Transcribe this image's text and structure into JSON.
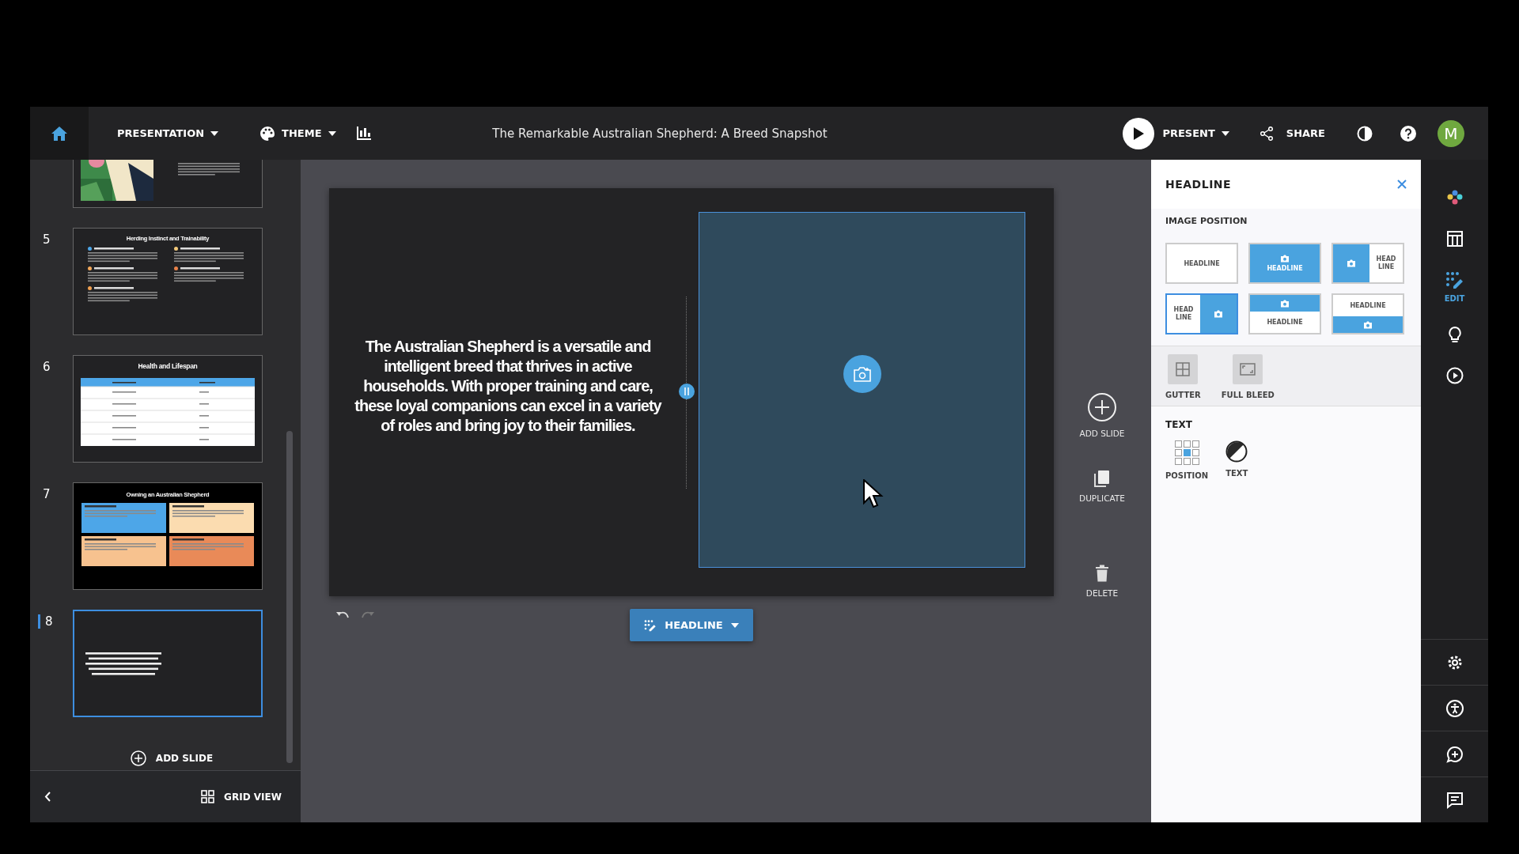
{
  "topbar": {
    "menus": [
      {
        "kind": "presentation",
        "label": "PRESENTATION"
      },
      {
        "kind": "theme",
        "label": "THEME"
      }
    ],
    "title": "The Remarkable Australian Shepherd: A Breed Snapshot",
    "present": "PRESENT",
    "share": "SHARE",
    "avatar": "M"
  },
  "slides": [
    {
      "kind": "photo-text",
      "selected": false
    },
    {
      "kind": "bullets",
      "number": "5",
      "title": "Herding Instinct and Trainability",
      "selected": false,
      "bullets": [
        {
          "color": "#4da6e8"
        },
        {
          "color": "#f3c97a"
        },
        {
          "color": "#f3a85a"
        },
        {
          "color": "#e9824a"
        },
        {
          "color": "#f0a050"
        }
      ]
    },
    {
      "kind": "table",
      "number": "6",
      "title": "Health and Lifespan",
      "selected": false
    },
    {
      "kind": "cards",
      "number": "7",
      "title": "Owning an Australian Shepherd",
      "selected": false,
      "cards": [
        {
          "color": "#4da6e8"
        },
        {
          "color": "#fbdcb0"
        },
        {
          "color": "#f7c28f"
        },
        {
          "color": "#e98a58"
        }
      ]
    },
    {
      "kind": "text",
      "number": "8",
      "selected": true
    }
  ],
  "add_slide": "ADD SLIDE",
  "grid_view": "GRID VIEW",
  "slide": {
    "text": "The Australian Shepherd is a versatile and intelligent breed that thrives in active households. With proper training and care, these loyal companions can excel in a variety of roles and bring joy to their families."
  },
  "layout_button": "HEADLINE",
  "actions": [
    {
      "kind": "add",
      "label": "ADD SLIDE"
    },
    {
      "kind": "duplicate",
      "label": "DUPLICATE"
    },
    {
      "kind": "delete",
      "label": "DELETE"
    }
  ],
  "panel": {
    "title": "HEADLINE",
    "image_position_label": "IMAGE POSITION",
    "layouts": [
      {
        "kind": "text-only",
        "label": "HEADLINE",
        "selected": false
      },
      {
        "kind": "image-behind",
        "label": "HEADLINE",
        "selected": false
      },
      {
        "kind": "image-left",
        "label": "HEAD LINE",
        "selected": false
      },
      {
        "kind": "image-right",
        "label": "HEAD LINE",
        "selected": true
      },
      {
        "kind": "image-top",
        "label": "HEADLINE",
        "selected": false
      },
      {
        "kind": "image-bottom",
        "label": "HEADLINE",
        "selected": false
      }
    ],
    "image_options": [
      {
        "kind": "gutter",
        "label": "GUTTER"
      },
      {
        "kind": "full-bleed",
        "label": "FULL BLEED"
      }
    ],
    "text_label": "TEXT",
    "text_options": [
      {
        "kind": "position",
        "label": "POSITION"
      },
      {
        "kind": "color",
        "label": "TEXT"
      }
    ],
    "position_grid": [
      {
        "selected": false
      },
      {
        "selected": false
      },
      {
        "selected": false
      },
      {
        "selected": false
      },
      {
        "selected": true
      },
      {
        "selected": false
      },
      {
        "selected": false
      },
      {
        "selected": false
      },
      {
        "selected": false
      }
    ]
  },
  "rail": [
    {
      "kind": "colors",
      "selected": false
    },
    {
      "kind": "layout",
      "selected": false
    },
    {
      "kind": "edit",
      "label": "EDIT",
      "selected": true
    },
    {
      "kind": "ideas",
      "selected": false
    },
    {
      "kind": "play",
      "selected": false
    },
    {
      "kind": "settings",
      "selected": false
    },
    {
      "kind": "accessibility",
      "selected": false
    },
    {
      "kind": "comment",
      "selected": false
    },
    {
      "kind": "notes",
      "selected": false
    }
  ]
}
